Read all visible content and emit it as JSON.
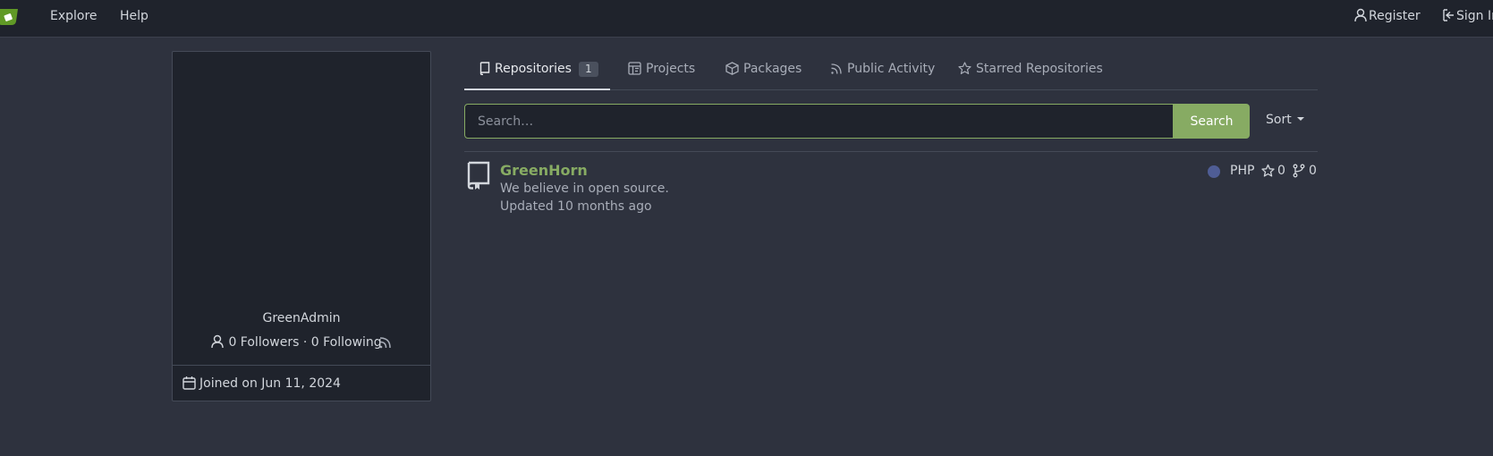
{
  "navbar": {
    "logo_icon": "gitea-logo-icon",
    "explore_label": "Explore",
    "help_label": "Help",
    "register_label": "Register",
    "signin_label": "Sign In"
  },
  "profile": {
    "username": "GreenAdmin",
    "followers_text": "0 Followers",
    "separator": "·",
    "following_text": "0 Following",
    "joined_text": "Joined on Jun 11, 2024"
  },
  "tabs": [
    {
      "label": "Repositories",
      "count": "1",
      "icon": "repo-icon",
      "active": true
    },
    {
      "label": "Projects",
      "icon": "project-icon",
      "active": false
    },
    {
      "label": "Packages",
      "icon": "package-icon",
      "active": false
    },
    {
      "label": "Public Activity",
      "icon": "rss-icon",
      "active": false
    },
    {
      "label": "Starred Repositories",
      "icon": "star-icon",
      "active": false
    }
  ],
  "search": {
    "placeholder": "Search…",
    "value": "",
    "button_label": "Search",
    "sort_label": "Sort"
  },
  "repositories": [
    {
      "name": "GreenHorn",
      "description": "We believe in open source.",
      "updated": "Updated 10 months ago",
      "language": "PHP",
      "language_color": "#4f5d95",
      "stars": "0",
      "forks": "0"
    }
  ],
  "colors": {
    "accent": "#87ab63",
    "background": "#2e323e",
    "panel": "#1f232c"
  }
}
